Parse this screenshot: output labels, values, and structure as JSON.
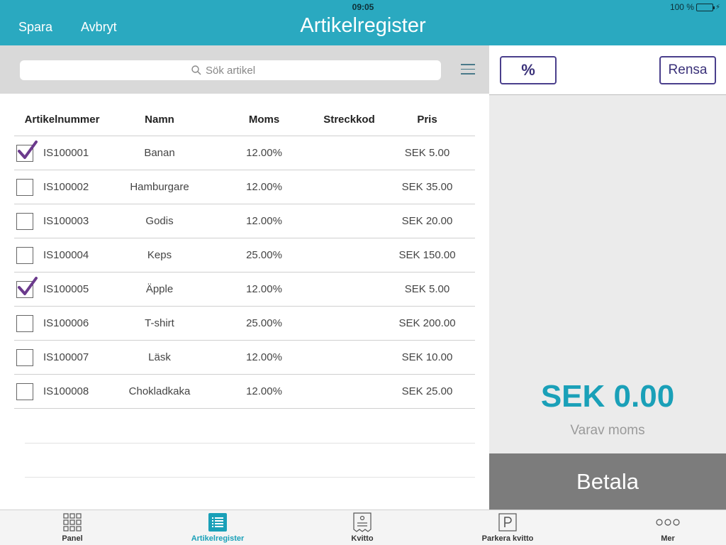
{
  "status": {
    "time": "09:05",
    "battery": "100 %"
  },
  "header": {
    "save_label": "Spara",
    "cancel_label": "Avbryt",
    "title": "Artikelregister"
  },
  "search": {
    "placeholder": "Sök artikel",
    "value": ""
  },
  "table": {
    "columns": [
      "Artikelnummer",
      "Namn",
      "Moms",
      "Streckkod",
      "Pris"
    ],
    "rows": [
      {
        "checked": true,
        "number": "IS100001",
        "name": "Banan",
        "vat": "12.00%",
        "barcode": "",
        "price": "SEK 5.00"
      },
      {
        "checked": false,
        "number": "IS100002",
        "name": "Hamburgare",
        "vat": "12.00%",
        "barcode": "",
        "price": "SEK 35.00"
      },
      {
        "checked": false,
        "number": "IS100003",
        "name": "Godis",
        "vat": "12.00%",
        "barcode": "",
        "price": "SEK 20.00"
      },
      {
        "checked": false,
        "number": "IS100004",
        "name": "Keps",
        "vat": "25.00%",
        "barcode": "",
        "price": "SEK 150.00"
      },
      {
        "checked": true,
        "number": "IS100005",
        "name": "Äpple",
        "vat": "12.00%",
        "barcode": "",
        "price": "SEK 5.00"
      },
      {
        "checked": false,
        "number": "IS100006",
        "name": "T-shirt",
        "vat": "25.00%",
        "barcode": "",
        "price": "SEK 200.00"
      },
      {
        "checked": false,
        "number": "IS100007",
        "name": "Läsk",
        "vat": "12.00%",
        "barcode": "",
        "price": "SEK 10.00"
      },
      {
        "checked": false,
        "number": "IS100008",
        "name": "Chokladkaka",
        "vat": "12.00%",
        "barcode": "",
        "price": "SEK 25.00"
      }
    ]
  },
  "cart": {
    "discount_label": "%",
    "clear_label": "Rensa",
    "total": "SEK 0.00",
    "vat_label": "Varav moms",
    "pay_label": "Betala"
  },
  "tabbar": {
    "items": [
      {
        "label": "Panel",
        "icon": "grid-icon",
        "active": false
      },
      {
        "label": "Artikelregister",
        "icon": "list-icon",
        "active": true
      },
      {
        "label": "Kvitto",
        "icon": "receipt-icon",
        "active": false
      },
      {
        "label": "Parkera kvitto",
        "icon": "parking-icon",
        "active": false
      },
      {
        "label": "Mer",
        "icon": "more-icon",
        "active": false
      }
    ]
  },
  "colors": {
    "accent": "#2aa9c0",
    "total": "#1aa0b8",
    "button_border": "#4a3f8c",
    "check": "#6b3a8c",
    "pay": "#7c7c7c"
  }
}
